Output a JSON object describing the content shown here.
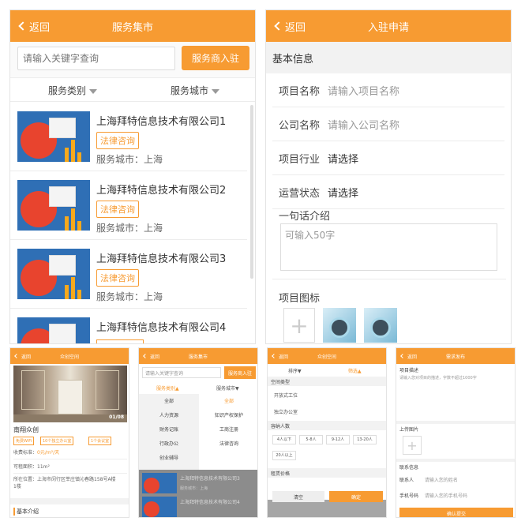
{
  "colors": {
    "accent": "#f79b32",
    "thumb_bg": "#2f6fb5",
    "thumb_red": "#e8442e"
  },
  "market": {
    "back": "返回",
    "title": "服务集市",
    "search_placeholder": "请输入关键字查询",
    "enter_button": "服务商入驻",
    "filter_category": "服务类别",
    "filter_city": "服务城市",
    "items": [
      {
        "name": "上海拜特信息技术有限公司1",
        "tag": "法律咨询",
        "city": "服务城市：上海"
      },
      {
        "name": "上海拜特信息技术有限公司2",
        "tag": "法律咨询",
        "city": "服务城市：上海"
      },
      {
        "name": "上海拜特信息技术有限公司3",
        "tag": "法律咨询",
        "city": "服务城市：上海"
      },
      {
        "name": "上海拜特信息技术有限公司4",
        "tag": "",
        "city": ""
      }
    ]
  },
  "apply": {
    "back": "返回",
    "title": "入驻申请",
    "section": "基本信息",
    "project_name_label": "项目名称",
    "project_name_placeholder": "请输入项目名称",
    "company_label": "公司名称",
    "company_placeholder": "请输入公司名称",
    "industry_label": "项目行业",
    "industry_value": "请选择",
    "status_label": "运营状态",
    "status_value": "请选择",
    "intro_label": "一句话介绍",
    "intro_placeholder": "可输入50字",
    "icon_label": "项目图标"
  },
  "detail": {
    "back": "返回",
    "title": "众创空间",
    "photo_counter": "01/08",
    "name": "南翔众创",
    "tags": [
      "免费WiFi",
      "10个独立办公室",
      "1个会议室"
    ],
    "price_label": "收费标准：",
    "price_value": "0元/m²/天",
    "area": "可租面积：11m²",
    "address": "所在位置：上海市闵行区莘庄镇沁春路158号A楼1楼",
    "section": "基本介绍"
  },
  "filter": {
    "back": "返回",
    "title": "服务集市",
    "search_placeholder": "请输入关键字查询",
    "enter_button": "服务商入驻",
    "tab_category": "服务类别",
    "tab_city": "服务城市",
    "left_items": [
      "全部",
      "人力资源",
      "财务记账",
      "行政办公",
      "创业辅导"
    ],
    "right_items": [
      "全部",
      "知识产权保护",
      "工商注册",
      "法律咨询"
    ],
    "list_name": "上海拜特信息技术有限公司3",
    "list_city": "服务城市：上海",
    "list_name2": "上海拜特信息技术有限公司4"
  },
  "space_filter": {
    "back": "返回",
    "title": "众创空间",
    "tab_left": "排序",
    "tab_right": "筛选",
    "group1": "空间类型",
    "group1_items": [
      "开放式工位",
      "独立办公室"
    ],
    "group2": "容纳人数",
    "group2_options": [
      "4人以下",
      "5-8人",
      "9-12人",
      "13-20人",
      "20人以上"
    ],
    "group3": "租赁价格",
    "reset": "清空",
    "confirm": "确定"
  },
  "demand": {
    "back": "返回",
    "title": "需求发布",
    "desc_label": "项目描述",
    "desc_placeholder": "请输入您对项目的描述，字数不超过1000字",
    "image_label": "上传图片",
    "contact_label": "联系信息",
    "contact_name_label": "联系人",
    "contact_name_placeholder": "请输入您的姓名",
    "phone_label": "手机号码",
    "phone_placeholder": "请输入您的手机号码",
    "submit": "确认提交"
  }
}
